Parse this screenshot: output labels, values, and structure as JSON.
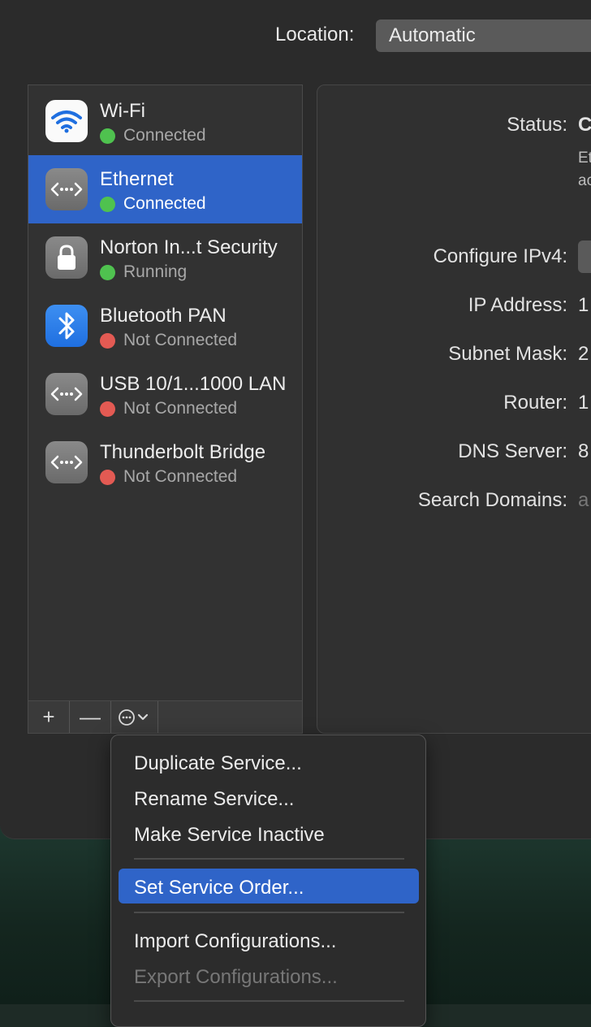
{
  "location": {
    "label": "Location:",
    "value": "Automatic"
  },
  "services": [
    {
      "name": "Wi-Fi",
      "status": "Connected",
      "status_color": "#4fc24f",
      "icon": "wifi-icon",
      "selected": false
    },
    {
      "name": "Ethernet",
      "status": "Connected",
      "status_color": "#4fc24f",
      "icon": "ethernet-icon",
      "selected": true
    },
    {
      "name": "Norton In...t Security",
      "status": "Running",
      "status_color": "#4fc24f",
      "icon": "lock-icon",
      "selected": false
    },
    {
      "name": "Bluetooth PAN",
      "status": "Not Connected",
      "status_color": "#e35a53",
      "icon": "bluetooth-icon",
      "selected": false
    },
    {
      "name": "USB 10/1...1000 LAN",
      "status": "Not Connected",
      "status_color": "#e35a53",
      "icon": "ethernet-icon",
      "selected": false
    },
    {
      "name": "Thunderbolt Bridge",
      "status": "Not Connected",
      "status_color": "#e35a53",
      "icon": "ethernet-icon",
      "selected": false
    }
  ],
  "toolbar": {
    "add": "+",
    "remove": "—"
  },
  "detail": {
    "status_label": "Status:",
    "status_value": "C",
    "status_desc_1": "Et",
    "status_desc_2": "ac",
    "configure_label": "Configure IPv4:",
    "ip_label": "IP Address:",
    "ip_value": "1",
    "subnet_label": "Subnet Mask:",
    "subnet_value": "2",
    "router_label": "Router:",
    "router_value": "1",
    "dns_label": "DNS Server:",
    "dns_value": "8",
    "search_label": "Search Domains:",
    "search_value": "a"
  },
  "menu": {
    "items": [
      {
        "label": "Duplicate Service...",
        "enabled": true
      },
      {
        "label": "Rename Service...",
        "enabled": true
      },
      {
        "label": "Make Service Inactive",
        "enabled": true
      },
      {
        "label": "Set Service Order...",
        "enabled": true,
        "highlighted": true
      },
      {
        "label": "Import Configurations...",
        "enabled": true
      },
      {
        "label": "Export Configurations...",
        "enabled": false
      }
    ]
  },
  "colors": {
    "accent": "#2f64c8",
    "connected": "#4fc24f",
    "not_connected": "#e35a53"
  }
}
